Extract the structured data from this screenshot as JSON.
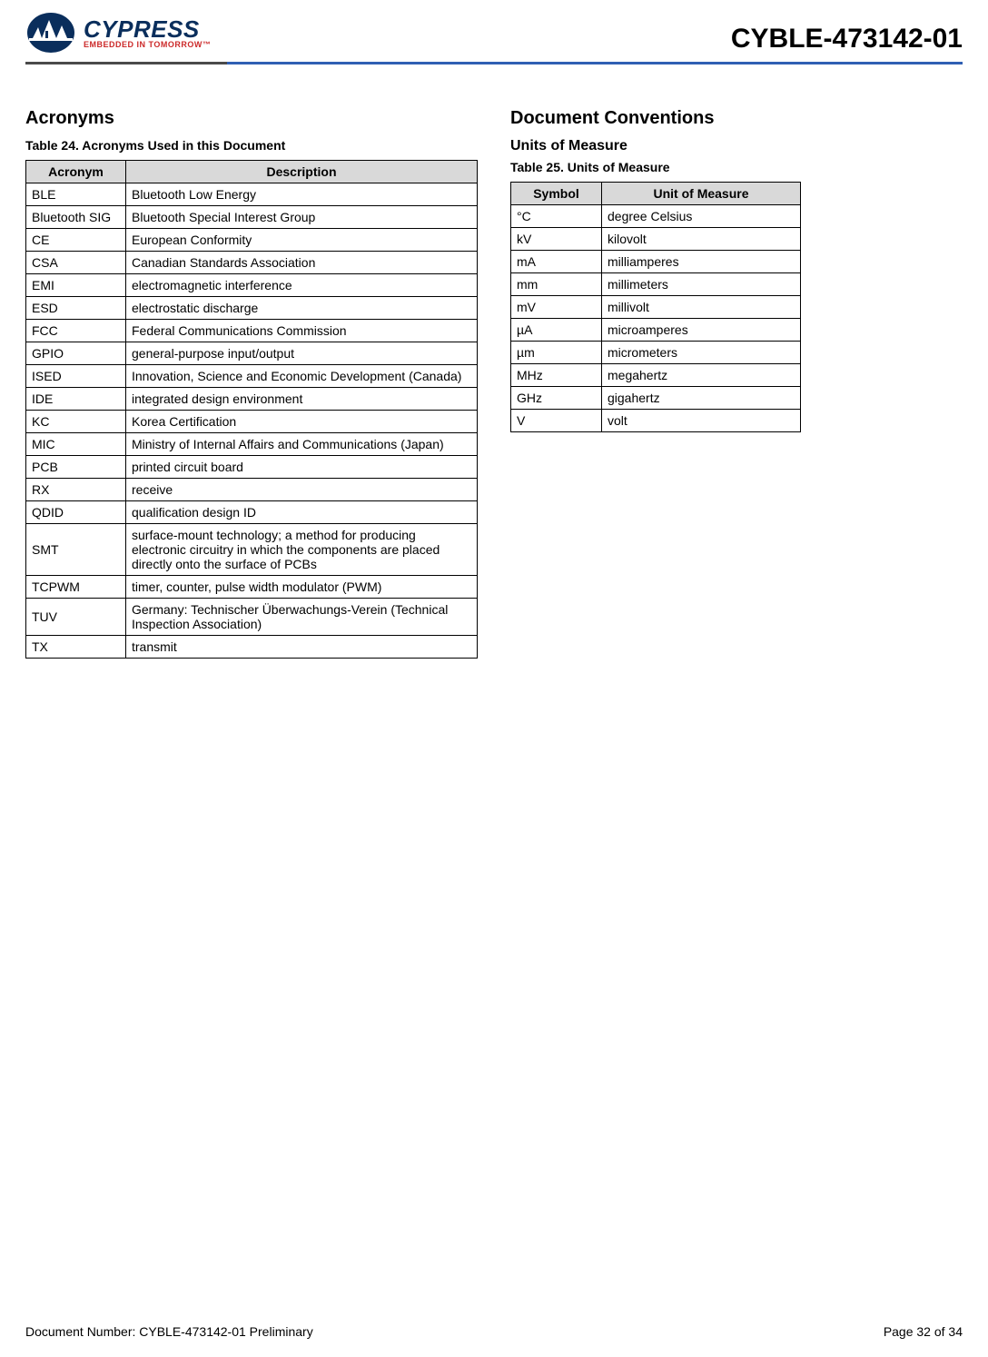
{
  "header": {
    "brand_word": "CYPRESS",
    "brand_tag": "EMBEDDED IN TOMORROW™",
    "doc_title": "CYBLE-473142-01"
  },
  "left": {
    "heading": "Acronyms",
    "table_caption": "Table 24.  Acronyms Used in this Document",
    "th_acronym": "Acronym",
    "th_description": "Description",
    "rows": [
      {
        "a": "BLE",
        "d": "Bluetooth Low Energy"
      },
      {
        "a": "Bluetooth SIG",
        "d": "Bluetooth Special Interest Group"
      },
      {
        "a": "CE",
        "d": "European Conformity"
      },
      {
        "a": "CSA",
        "d": "Canadian Standards Association"
      },
      {
        "a": "EMI",
        "d": "electromagnetic interference"
      },
      {
        "a": "ESD",
        "d": "electrostatic discharge"
      },
      {
        "a": "FCC",
        "d": "Federal Communications Commission"
      },
      {
        "a": "GPIO",
        "d": "general-purpose input/output"
      },
      {
        "a": "ISED",
        "d": "Innovation, Science and Economic Development (Canada)"
      },
      {
        "a": "IDE",
        "d": "integrated design environment"
      },
      {
        "a": "KC",
        "d": "Korea Certification"
      },
      {
        "a": "MIC",
        "d": "Ministry of Internal Affairs and Communications (Japan)"
      },
      {
        "a": "PCB",
        "d": "printed circuit board"
      },
      {
        "a": "RX",
        "d": "receive"
      },
      {
        "a": "QDID",
        "d": "qualification design ID"
      },
      {
        "a": "SMT",
        "d": "surface-mount technology; a method for producing electronic circuitry in which the components are placed directly onto the surface of PCBs"
      },
      {
        "a": "TCPWM",
        "d": "timer, counter, pulse width modulator (PWM)"
      },
      {
        "a": "TUV",
        "d": "Germany: Technischer Überwachungs-Verein (Technical Inspection Association)"
      },
      {
        "a": "TX",
        "d": "transmit"
      }
    ]
  },
  "right": {
    "heading": "Document Conventions",
    "subheading": "Units of Measure",
    "table_caption": "Table 25.  Units of Measure",
    "th_symbol": "Symbol",
    "th_unit": "Unit of Measure",
    "rows": [
      {
        "s": "°C",
        "u": "degree Celsius"
      },
      {
        "s": "kV",
        "u": "kilovolt"
      },
      {
        "s": "mA",
        "u": "milliamperes"
      },
      {
        "s": "mm",
        "u": "millimeters"
      },
      {
        "s": "mV",
        "u": "millivolt"
      },
      {
        "s": "µA",
        "u": "microamperes"
      },
      {
        "s": "µm",
        "u": "micrometers"
      },
      {
        "s": "MHz",
        "u": "megahertz"
      },
      {
        "s": "GHz",
        "u": "gigahertz"
      },
      {
        "s": "V",
        "u": "volt"
      }
    ]
  },
  "footer": {
    "doc_number": "Document Number: CYBLE-473142-01 Preliminary",
    "page_info": "Page 32 of 34"
  }
}
